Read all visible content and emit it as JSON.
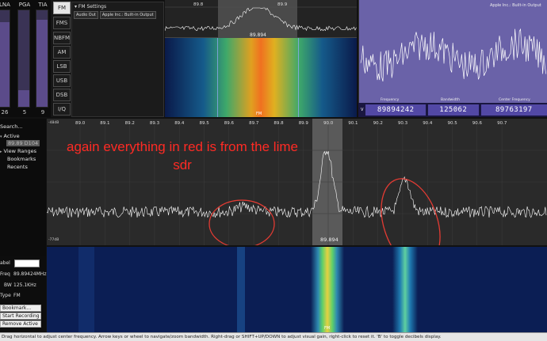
{
  "gains": [
    {
      "label": "LNA",
      "value": "26",
      "level": 0.88
    },
    {
      "label": "PGA",
      "value": "5",
      "level": 0.17
    },
    {
      "label": "TIA",
      "value": "9",
      "level": 0.9
    }
  ],
  "modes": [
    "FM",
    "FMS",
    "NBFM",
    "AM",
    "LSB",
    "USB",
    "DSB",
    "I/Q"
  ],
  "active_mode": "FM",
  "settings": {
    "title": "FM Settings",
    "audio_out_label": "Audio Out",
    "audio_device": "Apple Inc.: Built-in Output"
  },
  "mini_spectrum": {
    "ticks": [
      "89.8",
      "89.9"
    ],
    "center_label": "89.894"
  },
  "mini_waterfall": {
    "mode_tag": "FM"
  },
  "scope": {
    "title": "Apple Inc.: Built-in Output",
    "labels": [
      "Frequency",
      "Bandwidth",
      "Center Frequency"
    ]
  },
  "readouts": {
    "tag": "V",
    "frequency": "89894242",
    "bandwidth": "125062",
    "center_frequency": "89763197"
  },
  "sidebar": {
    "search": "Search...",
    "items": [
      "Active",
      "89.89 D104",
      "View Ranges",
      "Bookmarks",
      "Recents"
    ]
  },
  "spectrum": {
    "ticks": [
      "89.0",
      "89.1",
      "89.2",
      "89.3",
      "89.4",
      "89.5",
      "89.6",
      "89.7",
      "89.8",
      "89.9",
      "90.0",
      "90.1",
      "90.2",
      "90.3",
      "90.4",
      "90.5",
      "90.6",
      "90.7"
    ],
    "db_top": "-48dB",
    "db_bottom": "-77dB",
    "center_label": "89.894"
  },
  "waterfall": {
    "mode_tag": "FM"
  },
  "info": {
    "label_label": "abel",
    "freq_label": "Freq",
    "freq_value": "89.89424MHz",
    "bw_label": "BW",
    "bw_value": "125.1KHz",
    "type_label": "Type",
    "type_value": "FM"
  },
  "buttons": {
    "bookmark": "Bookmark...",
    "start_recording": "Start Recording",
    "remove_active": "Remove Active"
  },
  "status_bar": "Drag horizontal to adjust center frequency. Arrow keys or wheel to navigate/zoom bandwidth. Right-drag or SHIFT+UP/DOWN to adjust visual gain, right-click to reset it. 'B' to toggle decibels display.",
  "annotation": "again everything in red is from the lime sdr",
  "colors": {
    "annotation_red": "#ff2a24",
    "slider_purple": "#5b4b8a",
    "readout_purple": "#5248a5",
    "scope_purple": "#6a62a8"
  }
}
